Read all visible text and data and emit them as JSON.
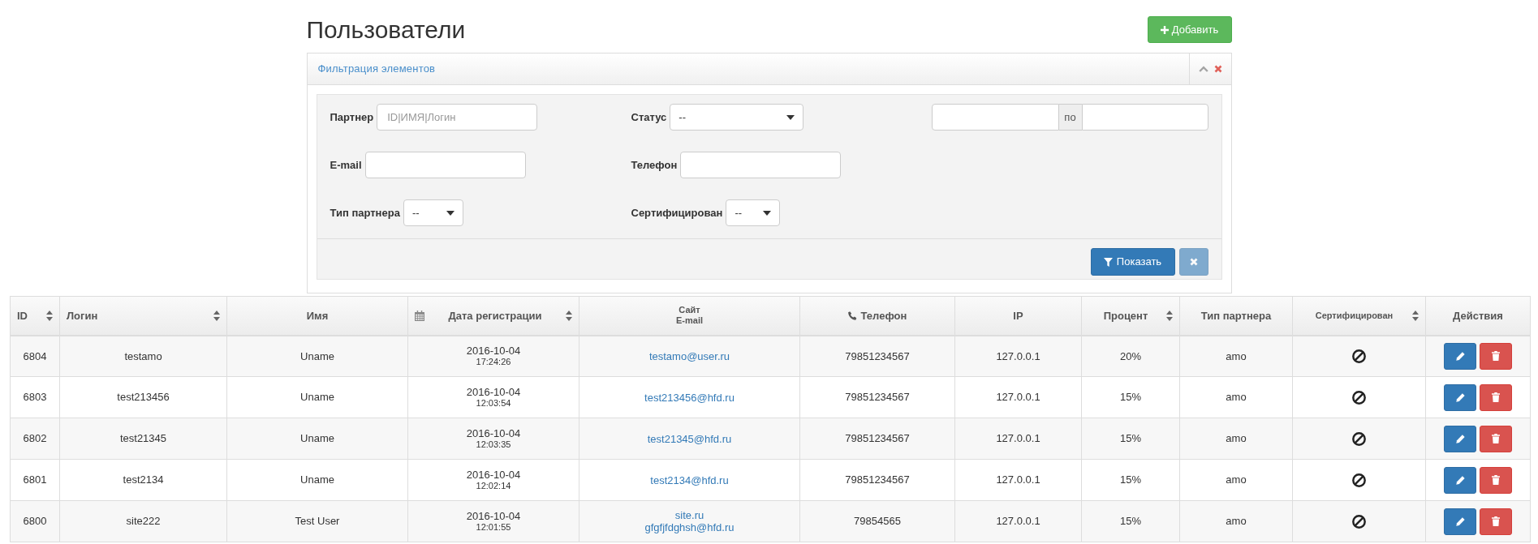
{
  "page": {
    "title": "Пользователи",
    "add_button": {
      "label": "Добавить"
    }
  },
  "filter_panel": {
    "title": "Фильтрация элементов",
    "rows": [
      [
        {
          "kind": "text",
          "label": "Партнер",
          "placeholder": "ID|ИМЯ|Логин"
        },
        {
          "kind": "select",
          "label": "Статус",
          "value": "--"
        },
        {
          "kind": "range",
          "separator": "по"
        }
      ],
      [
        {
          "kind": "text",
          "label": "E-mail"
        },
        {
          "kind": "text",
          "label": "Телефон"
        }
      ],
      [
        {
          "kind": "select",
          "label": "Тип партнера",
          "value": "--"
        },
        {
          "kind": "select",
          "label": "Сертифицирован",
          "value": "--"
        }
      ]
    ],
    "buttons": [
      {
        "kind": "submit",
        "label": "Показать",
        "disabled": false
      },
      {
        "kind": "reset",
        "disabled": true
      }
    ]
  },
  "table": {
    "columns": [
      {
        "kind": "plain",
        "label": "ID",
        "sortable": true
      },
      {
        "kind": "plain",
        "label": "Логин",
        "sortable": true
      },
      {
        "kind": "plain",
        "label": "Имя",
        "sortable": false
      },
      {
        "kind": "date",
        "label": "Дата регистрации",
        "sortable": true
      },
      {
        "kind": "stacked",
        "lines": [
          "Сайт",
          "E-mail"
        ],
        "sortable": false
      },
      {
        "kind": "phone",
        "label": "Телефон",
        "sortable": false
      },
      {
        "kind": "plain",
        "label": "IP",
        "sortable": false
      },
      {
        "kind": "plain",
        "label": "Процент",
        "sortable": true
      },
      {
        "kind": "plain",
        "label": "Тип партнера",
        "sortable": false
      },
      {
        "kind": "compact",
        "label": "Сертифицирован",
        "sortable": true
      },
      {
        "kind": "plain",
        "label": "Действия",
        "sortable": false
      }
    ],
    "rows": [
      {
        "id": "6804",
        "login": "testamo",
        "name": "Uname",
        "date": "2016-10-04",
        "time": "17:24:26",
        "contacts": [
          "testamo@user.ru"
        ],
        "phone": "79851234567",
        "ip": "127.0.0.1",
        "percent": "20%",
        "partner_type": "amo",
        "certified": false
      },
      {
        "id": "6803",
        "login": "test213456",
        "name": "Uname",
        "date": "2016-10-04",
        "time": "12:03:54",
        "contacts": [
          "test213456@hfd.ru"
        ],
        "phone": "79851234567",
        "ip": "127.0.0.1",
        "percent": "15%",
        "partner_type": "amo",
        "certified": false
      },
      {
        "id": "6802",
        "login": "test21345",
        "name": "Uname",
        "date": "2016-10-04",
        "time": "12:03:35",
        "contacts": [
          "test21345@hfd.ru"
        ],
        "phone": "79851234567",
        "ip": "127.0.0.1",
        "percent": "15%",
        "partner_type": "amo",
        "certified": false
      },
      {
        "id": "6801",
        "login": "test2134",
        "name": "Uname",
        "date": "2016-10-04",
        "time": "12:02:14",
        "contacts": [
          "test2134@hfd.ru"
        ],
        "phone": "79851234567",
        "ip": "127.0.0.1",
        "percent": "15%",
        "partner_type": "amo",
        "certified": false
      },
      {
        "id": "6800",
        "login": "site222",
        "name": "Test User",
        "date": "2016-10-04",
        "time": "12:01:55",
        "contacts": [
          "site.ru",
          "gfgfjfdghsh@hfd.ru"
        ],
        "phone": "79854565",
        "ip": "127.0.0.1",
        "percent": "15%",
        "partner_type": "amo",
        "certified": false
      }
    ]
  }
}
